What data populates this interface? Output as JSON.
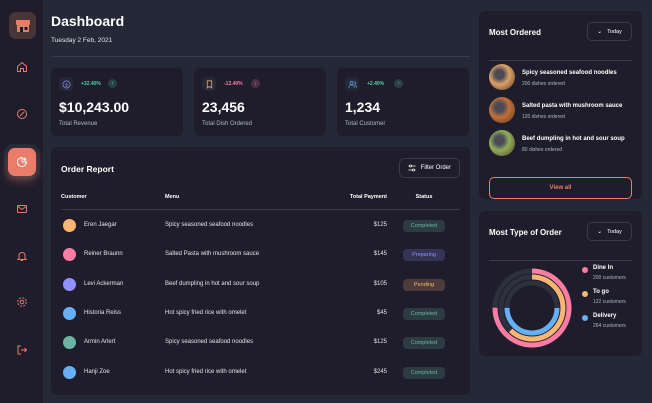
{
  "header": {
    "title": "Dashboard",
    "date": "Tuesday 2 Feb, 2021"
  },
  "stats": [
    {
      "icon": "dollar-icon",
      "change": "+32.40%",
      "trend": "up",
      "value": "$10,243.00",
      "label": "Total Revenue"
    },
    {
      "icon": "bookmark-icon",
      "change": "-12.40%",
      "trend": "down",
      "value": "23,456",
      "label": "Total Dish Ordered"
    },
    {
      "icon": "users-icon",
      "change": "+2.40%",
      "trend": "up",
      "value": "1,234",
      "label": "Total Customer"
    }
  ],
  "order_report": {
    "title": "Order Report",
    "filter_label": "Filter Order",
    "columns": [
      "Customer",
      "Menu",
      "Total Payment",
      "Status"
    ],
    "rows": [
      {
        "customer": "Eren Jaegar",
        "menu": "Spicy seasoned seafood noodles",
        "payment": "$125",
        "status": "Completed",
        "status_key": "completed",
        "avatar_color": "#ffb572"
      },
      {
        "customer": "Reiner Braunn",
        "menu": "Salted Pasta with mushroom sauce",
        "payment": "$145",
        "status": "Preparing",
        "status_key": "preparing",
        "avatar_color": "#ff7ca3"
      },
      {
        "customer": "Levi Ackerman",
        "menu": "Beef dumpling in hot and sour soup",
        "payment": "$105",
        "status": "Pending",
        "status_key": "pending",
        "avatar_color": "#9290fe"
      },
      {
        "customer": "Historia Reiss",
        "menu": "Hot spicy fried rice with omelet",
        "payment": "$45",
        "status": "Completed",
        "status_key": "completed",
        "avatar_color": "#65b0f6"
      },
      {
        "customer": "Armin Arlert",
        "menu": "Spicy seasoned seafood noodles",
        "payment": "$125",
        "status": "Completed",
        "status_key": "completed",
        "avatar_color": "#6bb3a3"
      },
      {
        "customer": "Hanji Zoe",
        "menu": "Hot spicy fried rice with omelet",
        "payment": "$245",
        "status": "Completed",
        "status_key": "completed",
        "avatar_color": "#65b0f6"
      }
    ]
  },
  "most_ordered": {
    "title": "Most Ordered",
    "period": "Today",
    "items": [
      {
        "name": "Spicy seasoned seafood noodles",
        "count": "200 dishes ordered",
        "color": "#d9a066"
      },
      {
        "name": "Salted pasta with mushroom sauce",
        "count": "120 dishes ordered",
        "color": "#c0703a"
      },
      {
        "name": "Beef dumpling in hot and sour soup",
        "count": "80 dishes ordered",
        "color": "#8fae5a"
      }
    ],
    "view_all": "View all"
  },
  "order_types": {
    "title": "Most Type of Order",
    "period": "Today",
    "items": [
      {
        "name": "Dine In",
        "count": "200 customers",
        "color": "#ff7ca3",
        "share": 0.75
      },
      {
        "name": "To go",
        "count": "122 customers",
        "color": "#ffb572",
        "share": 0.62
      },
      {
        "name": "Delivery",
        "count": "264 customers",
        "color": "#65b0f6",
        "share": 0.5
      }
    ]
  },
  "colors": {
    "accent": "#ea7c69",
    "bg": "#252836",
    "panel": "#1f1d2b",
    "up": "#50d1aa",
    "down": "#ff7ca3"
  },
  "nav": [
    "home-icon",
    "discount-icon",
    "dashboard-icon",
    "message-icon",
    "notification-icon",
    "settings-icon",
    "logout-icon"
  ]
}
